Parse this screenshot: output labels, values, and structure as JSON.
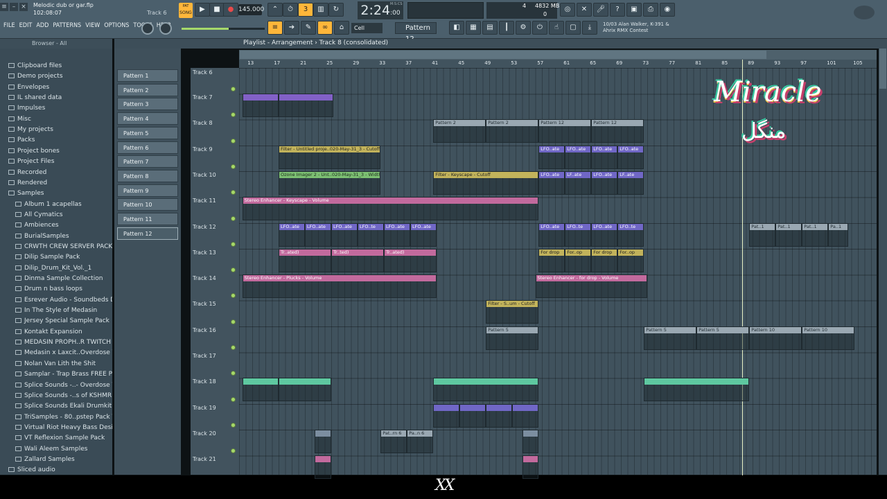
{
  "window": {
    "filename": "Melodic dub or gar.flp",
    "time": "102:08:07",
    "current_track": "Track 6"
  },
  "menu": [
    "FILE",
    "EDIT",
    "ADD",
    "PATTERNS",
    "VIEW",
    "OPTIONS",
    "TOOLS",
    "HELP"
  ],
  "transport": {
    "mode": "SONG",
    "tempo": "145.000",
    "time": "2:24",
    "time_frac": ":00",
    "time_label": "M:S:CS",
    "cpu": "4",
    "memory": "4832 MB",
    "memory_b": "0"
  },
  "news": {
    "line1": "10/03  Alan Walker, K-391 &",
    "line2": "Ahrix RMX Contest"
  },
  "toolbar": {
    "pattern": "Pattern 12",
    "snap": "Cell"
  },
  "browser": {
    "label": "Browser - All",
    "items": [
      {
        "label": "Clipboard files",
        "indent": 0
      },
      {
        "label": "Demo projects",
        "indent": 0
      },
      {
        "label": "Envelopes",
        "indent": 0
      },
      {
        "label": "IL shared data",
        "indent": 0
      },
      {
        "label": "Impulses",
        "indent": 0
      },
      {
        "label": "Misc",
        "indent": 0
      },
      {
        "label": "My projects",
        "indent": 0
      },
      {
        "label": "Packs",
        "indent": 0
      },
      {
        "label": "Project bones",
        "indent": 0
      },
      {
        "label": "Project Files",
        "indent": 0
      },
      {
        "label": "Recorded",
        "indent": 0
      },
      {
        "label": "Rendered",
        "indent": 0
      },
      {
        "label": "Samples",
        "indent": 0
      },
      {
        "label": "Album 1 acapellas",
        "indent": 1
      },
      {
        "label": "All Cymatics",
        "indent": 1
      },
      {
        "label": "Ambiences",
        "indent": 1
      },
      {
        "label": "BurialSamples",
        "indent": 1
      },
      {
        "label": "CRWTH CREW SERVER PACK",
        "indent": 1
      },
      {
        "label": "Dilip Sample Pack",
        "indent": 1
      },
      {
        "label": "Dilip_Drum_Kit_Vol._1",
        "indent": 1
      },
      {
        "label": "Dinma Sample Collection",
        "indent": 1
      },
      {
        "label": "Drum n bass loops",
        "indent": 1
      },
      {
        "label": "Esrever Audio - Soundbeds Demo",
        "indent": 1
      },
      {
        "label": "In The Style of Medasin",
        "indent": 1
      },
      {
        "label": "Jersey Special Sample Pack",
        "indent": 1
      },
      {
        "label": "Kontakt Expansion",
        "indent": 1
      },
      {
        "label": "MEDASIN PROPH..R TWITCH CHAT",
        "indent": 1
      },
      {
        "label": "Medasin x Laxcit..Overdose Vol. 8",
        "indent": 1
      },
      {
        "label": "Nolan Van Lith the Shit",
        "indent": 1
      },
      {
        "label": "Samplar - Trap Brass FREE Pack",
        "indent": 1
      },
      {
        "label": "Splice Sounds -..- Overdose Vol. 7",
        "indent": 1
      },
      {
        "label": "Splice Sounds -..s of KSHMR Vol.3",
        "indent": 1
      },
      {
        "label": "Splice Sounds Ekali Drumkit Vol 2",
        "indent": 1
      },
      {
        "label": "TriSamples - 80..pstep Pack Vol 1",
        "indent": 1
      },
      {
        "label": "Virtual Riot Heavy Bass Design",
        "indent": 1
      },
      {
        "label": "VT Reflexion Sample Pack",
        "indent": 1
      },
      {
        "label": "Wali Aleem Samples",
        "indent": 1
      },
      {
        "label": "Zallard Samples",
        "indent": 1
      },
      {
        "label": "Sliced audio",
        "indent": 0
      }
    ]
  },
  "patterns": [
    "Pattern 1",
    "Pattern 2",
    "Pattern 3",
    "Pattern 4",
    "Pattern 5",
    "Pattern 6",
    "Pattern 7",
    "Pattern 8",
    "Pattern 9",
    "Pattern 10",
    "Pattern 11",
    "Pattern 12"
  ],
  "playlist": {
    "title": "Playlist - Arrangement › Track 8 (consolidated)",
    "ruler": [
      "13",
      "17",
      "21",
      "25",
      "29",
      "33",
      "37",
      "41",
      "45",
      "49",
      "53",
      "57",
      "61",
      "65",
      "69",
      "73",
      "77",
      "81",
      "85",
      "89",
      "93",
      "97",
      "101",
      "105"
    ],
    "tracks": [
      "Track 6",
      "Track 7",
      "Track 8",
      "Track 9",
      "Track 10",
      "Track 11",
      "Track 12",
      "Track 13",
      "Track 14",
      "Track 15",
      "Track 16",
      "Track 17",
      "Track 18",
      "Track 19",
      "Track 20",
      "Track 21"
    ],
    "clips": [
      {
        "track": 1,
        "from": 12,
        "to": 17.5,
        "label": "",
        "color": "pur"
      },
      {
        "track": 1,
        "from": 17.5,
        "to": 25.8,
        "label": "",
        "color": "pur"
      },
      {
        "track": 2,
        "from": 41,
        "to": 49,
        "label": "Pattern 2",
        "color": "gray"
      },
      {
        "track": 2,
        "from": 49,
        "to": 57,
        "label": "Pattern 2",
        "color": "gray"
      },
      {
        "track": 2,
        "from": 57,
        "to": 65,
        "label": "Pattern 12",
        "color": "gray"
      },
      {
        "track": 2,
        "from": 65,
        "to": 73,
        "label": "Pattern 12",
        "color": "gray"
      },
      {
        "track": 3,
        "from": 17.5,
        "to": 33,
        "label": "Filter - Untitled proje..020-May-31_3 - Cutoff",
        "color": "yel"
      },
      {
        "track": 3,
        "from": 57,
        "to": 61,
        "label": "LFO..ate",
        "color": "viol"
      },
      {
        "track": 3,
        "from": 61,
        "to": 65,
        "label": "LFO..ate",
        "color": "viol"
      },
      {
        "track": 3,
        "from": 65,
        "to": 69,
        "label": "LFO..ate",
        "color": "viol"
      },
      {
        "track": 3,
        "from": 69,
        "to": 73,
        "label": "LFO..ate",
        "color": "viol"
      },
      {
        "track": 4,
        "from": 17.5,
        "to": 33,
        "label": "Ozone Imager 2 - Unt..020-May-31_3 - Width",
        "color": "grn"
      },
      {
        "track": 4,
        "from": 41,
        "to": 57,
        "label": "Filter - Keyscape - Cutoff",
        "color": "yel"
      },
      {
        "track": 4,
        "from": 57,
        "to": 61,
        "label": "LFO..ate",
        "color": "viol"
      },
      {
        "track": 4,
        "from": 61,
        "to": 65,
        "label": "LF..ate",
        "color": "viol"
      },
      {
        "track": 4,
        "from": 65,
        "to": 69,
        "label": "LFO..ate",
        "color": "viol"
      },
      {
        "track": 4,
        "from": 69,
        "to": 73,
        "label": "LF..ate",
        "color": "viol"
      },
      {
        "track": 5,
        "from": 12,
        "to": 57,
        "label": "Stereo Enhancer - Keyscape - Volume",
        "color": "pink"
      },
      {
        "track": 6,
        "from": 17.5,
        "to": 21.5,
        "label": "LFO..ate",
        "color": "viol"
      },
      {
        "track": 6,
        "from": 21.5,
        "to": 25.5,
        "label": "LFO..ate",
        "color": "viol"
      },
      {
        "track": 6,
        "from": 25.5,
        "to": 29.5,
        "label": "LFO..ate",
        "color": "viol"
      },
      {
        "track": 6,
        "from": 29.5,
        "to": 33.5,
        "label": "LFO..te",
        "color": "viol"
      },
      {
        "track": 6,
        "from": 33.5,
        "to": 37.5,
        "label": "LFO..ate",
        "color": "viol"
      },
      {
        "track": 6,
        "from": 37.5,
        "to": 41.5,
        "label": "LFO..ate",
        "color": "viol"
      },
      {
        "track": 6,
        "from": 57,
        "to": 61,
        "label": "LFO..ate",
        "color": "viol"
      },
      {
        "track": 6,
        "from": 61,
        "to": 65,
        "label": "LFO..te",
        "color": "viol"
      },
      {
        "track": 6,
        "from": 65,
        "to": 69,
        "label": "LFO..ate",
        "color": "viol"
      },
      {
        "track": 6,
        "from": 69,
        "to": 73,
        "label": "LFO..te",
        "color": "viol"
      },
      {
        "track": 6,
        "from": 89,
        "to": 93,
        "label": "Pat..1",
        "color": "gray"
      },
      {
        "track": 6,
        "from": 93,
        "to": 97,
        "label": "Pat..1",
        "color": "gray"
      },
      {
        "track": 6,
        "from": 97,
        "to": 101,
        "label": "Pat..1",
        "color": "gray"
      },
      {
        "track": 6,
        "from": 101,
        "to": 104,
        "label": "Pa..1",
        "color": "gray"
      },
      {
        "track": 7,
        "from": 17.5,
        "to": 25.5,
        "label": "Tr..ated)",
        "color": "pink"
      },
      {
        "track": 7,
        "from": 25.5,
        "to": 33.5,
        "label": "Tr..ted)",
        "color": "pink"
      },
      {
        "track": 7,
        "from": 33.5,
        "to": 41.5,
        "label": "Tr..ated)",
        "color": "pink"
      },
      {
        "track": 7,
        "from": 57,
        "to": 61,
        "label": "For drop",
        "color": "yel"
      },
      {
        "track": 7,
        "from": 61,
        "to": 65,
        "label": "For..op",
        "color": "yel"
      },
      {
        "track": 7,
        "from": 65,
        "to": 69,
        "label": "For drop",
        "color": "yel"
      },
      {
        "track": 7,
        "from": 69,
        "to": 73,
        "label": "For..op",
        "color": "yel"
      },
      {
        "track": 8,
        "from": 12,
        "to": 41.5,
        "label": "Stereo Enhancer - Plucks - Volume",
        "color": "pink"
      },
      {
        "track": 8,
        "from": 56.5,
        "to": 73.5,
        "label": "Stereo Enhancer - for drop - Volume",
        "color": "pink"
      },
      {
        "track": 9,
        "from": 49,
        "to": 57,
        "label": "Filter - S..um - Cutoff",
        "color": "yel"
      },
      {
        "track": 10,
        "from": 49,
        "to": 57,
        "label": "Pattern 5",
        "color": "gray"
      },
      {
        "track": 10,
        "from": 73,
        "to": 81,
        "label": "Pattern 5",
        "color": "gray"
      },
      {
        "track": 10,
        "from": 81,
        "to": 89,
        "label": "Pattern 5",
        "color": "gray"
      },
      {
        "track": 10,
        "from": 89,
        "to": 97,
        "label": "Pattern 10",
        "color": "gray"
      },
      {
        "track": 10,
        "from": 97,
        "to": 105,
        "label": "Pattern 10",
        "color": "gray"
      },
      {
        "track": 12,
        "from": 12,
        "to": 17.5,
        "label": "",
        "color": "mint"
      },
      {
        "track": 12,
        "from": 17.5,
        "to": 25.5,
        "label": "",
        "color": "mint"
      },
      {
        "track": 12,
        "from": 41,
        "to": 57,
        "label": "",
        "color": "mint"
      },
      {
        "track": 12,
        "from": 73,
        "to": 89,
        "label": "",
        "color": "mint"
      },
      {
        "track": 13,
        "from": 41,
        "to": 45,
        "label": "",
        "color": "viol"
      },
      {
        "track": 13,
        "from": 45,
        "to": 49,
        "label": "",
        "color": "viol"
      },
      {
        "track": 13,
        "from": 49,
        "to": 53,
        "label": "",
        "color": "viol"
      },
      {
        "track": 13,
        "from": 53,
        "to": 57,
        "label": "",
        "color": "viol"
      },
      {
        "track": 14,
        "from": 23,
        "to": 25.5,
        "label": "",
        "color": "blue"
      },
      {
        "track": 14,
        "from": 33,
        "to": 37,
        "label": "Pat..rn 6",
        "color": "gray"
      },
      {
        "track": 14,
        "from": 37,
        "to": 41,
        "label": "Pa..n 6",
        "color": "gray"
      },
      {
        "track": 14,
        "from": 54.5,
        "to": 57,
        "label": "",
        "color": "blue"
      },
      {
        "track": 15,
        "from": 23,
        "to": 25.5,
        "label": "",
        "color": "pink"
      },
      {
        "track": 15,
        "from": 54.5,
        "to": 57,
        "label": "",
        "color": "pink"
      }
    ]
  },
  "overlay": {
    "title": "Miracle",
    "arabic": "منگل",
    "watermark": "XX"
  }
}
